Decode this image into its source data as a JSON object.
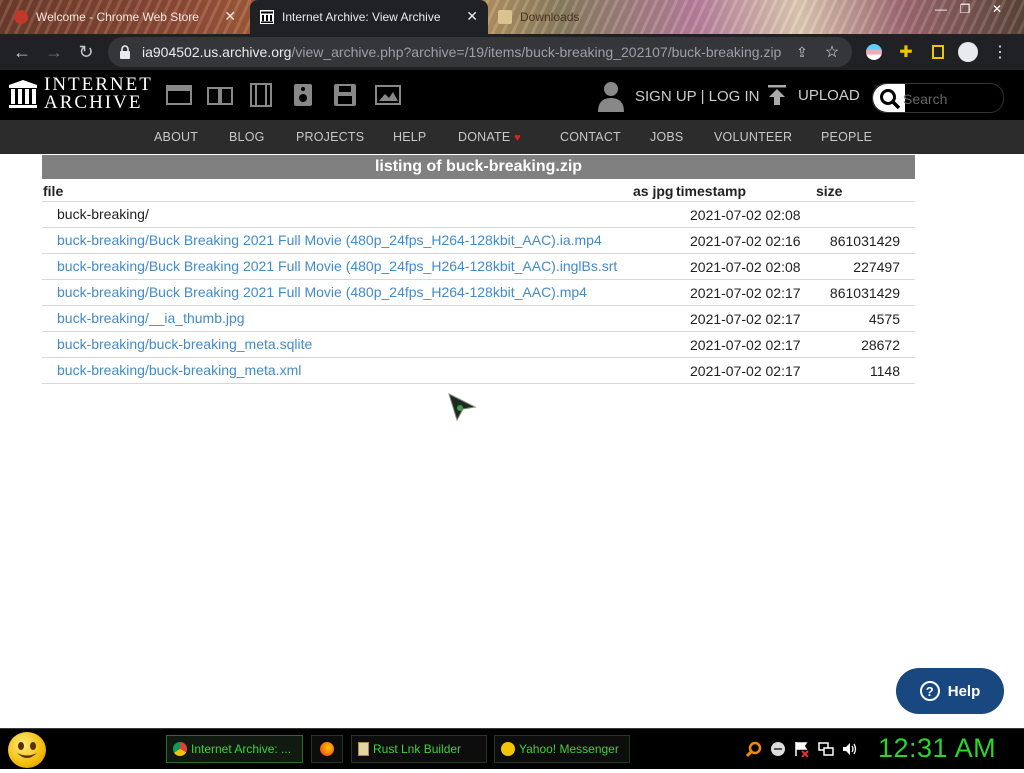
{
  "browser": {
    "tabs": [
      {
        "title": "Welcome - Chrome Web Store",
        "active": false
      },
      {
        "title": "Internet Archive: View Archive",
        "active": true
      },
      {
        "title": "Downloads",
        "active": false
      }
    ],
    "url_host": "ia904502.us.archive.org",
    "url_path": "/view_archive.php?archive=/19/items/buck-breaking_202107/buck-breaking.zip"
  },
  "ia_header": {
    "logo_line1": "INTERNET",
    "logo_line2": "ARCHIVE",
    "signup_label": "SIGN UP | LOG IN",
    "upload_label": "UPLOAD",
    "search_placeholder": "Search"
  },
  "nav": [
    "ABOUT",
    "BLOG",
    "PROJECTS",
    "HELP",
    "DONATE",
    "CONTACT",
    "JOBS",
    "VOLUNTEER",
    "PEOPLE"
  ],
  "listing": {
    "title": "listing of buck-breaking.zip",
    "headers": {
      "file": "file",
      "as_jpg": "as jpg",
      "timestamp": "timestamp",
      "size": "size"
    },
    "rows": [
      {
        "file": "buck-breaking/",
        "timestamp": "2021-07-02 02:08",
        "size": ""
      },
      {
        "file": "buck-breaking/Buck Breaking 2021 Full Movie (480p_24fps_H264-128kbit_AAC).ia.mp4",
        "timestamp": "2021-07-02 02:16",
        "size": "861031429"
      },
      {
        "file": "buck-breaking/Buck Breaking 2021 Full Movie (480p_24fps_H264-128kbit_AAC).inglBs.srt",
        "timestamp": "2021-07-02 02:08",
        "size": "227497"
      },
      {
        "file": "buck-breaking/Buck Breaking 2021 Full Movie (480p_24fps_H264-128kbit_AAC).mp4",
        "timestamp": "2021-07-02 02:17",
        "size": "861031429"
      },
      {
        "file": "buck-breaking/__ia_thumb.jpg",
        "timestamp": "2021-07-02 02:17",
        "size": "4575"
      },
      {
        "file": "buck-breaking/buck-breaking_meta.sqlite",
        "timestamp": "2021-07-02 02:17",
        "size": "28672"
      },
      {
        "file": "buck-breaking/buck-breaking_meta.xml",
        "timestamp": "2021-07-02 02:17",
        "size": "1148"
      }
    ]
  },
  "help_button": "Help",
  "taskbar": {
    "tasks": [
      "Internet Archive: ...",
      "Rust Lnk Builder",
      "Yahoo! Messenger"
    ],
    "clock": "12:31 AM"
  },
  "colors": {
    "link": "#428bca",
    "ia_black": "#000000",
    "nav_bg": "#2c2c2c",
    "help_blue": "#194880",
    "taskbar_green": "#29d629"
  }
}
